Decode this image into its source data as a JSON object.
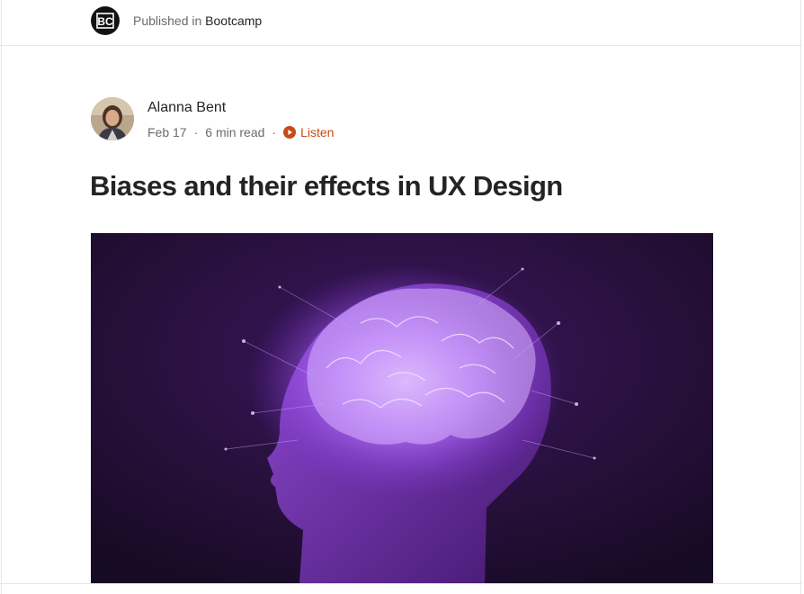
{
  "publication": {
    "prefix": "Published in",
    "name": "Bootcamp",
    "logo_icon": "bootcamp-logo-icon"
  },
  "author": {
    "name": "Alanna Bent",
    "avatar_icon": "author-avatar"
  },
  "meta": {
    "date": "Feb 17",
    "separator": "·",
    "read_time": "6 min read",
    "listen_label": "Listen",
    "listen_icon": "play-circle-icon",
    "listen_color": "#c94a14"
  },
  "article": {
    "title": "Biases and their effects in UX Design",
    "hero_image": "brain-head-illustration"
  },
  "colors": {
    "text_primary": "#242424",
    "text_secondary": "#6b6b6b",
    "divider": "#e6e6e6",
    "hero_background": "#2a0f3e",
    "hero_glow": "#b874ff"
  }
}
